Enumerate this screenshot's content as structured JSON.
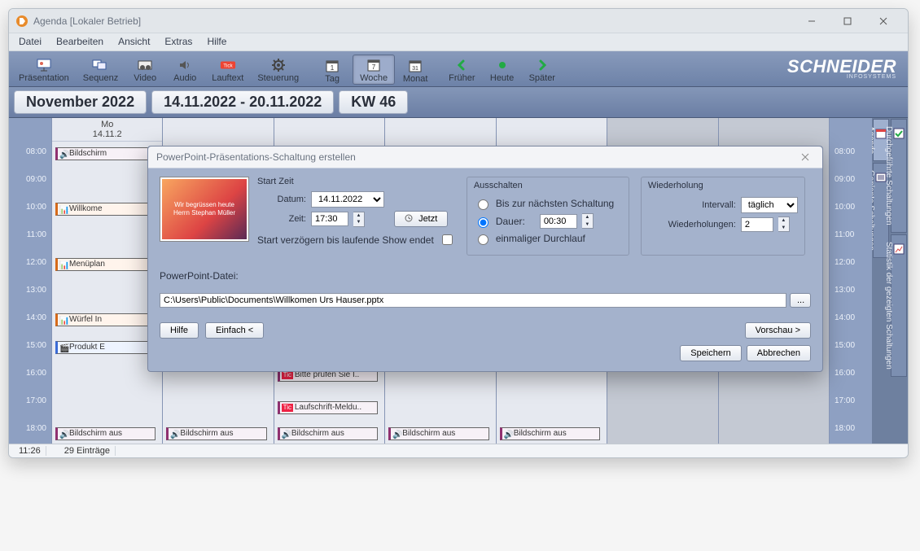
{
  "window": {
    "title": "Agenda [Lokaler Betrieb]"
  },
  "menu": [
    "Datei",
    "Bearbeiten",
    "Ansicht",
    "Extras",
    "Hilfe"
  ],
  "toolbar": {
    "praesentation": "Präsentation",
    "sequenz": "Sequenz",
    "video": "Video",
    "audio": "Audio",
    "lauftext": "Lauftext",
    "steuerung": "Steuerung",
    "tag": "Tag",
    "woche": "Woche",
    "monat": "Monat",
    "frueher": "Früher",
    "heute": "Heute",
    "spaeter": "Später",
    "brand": "SCHNEIDER",
    "brand_sub": "INFOSYSTEMS"
  },
  "date_header": {
    "month": "November 2022",
    "range": "14.11.2022 - 20.11.2022",
    "week": "KW 46"
  },
  "day_head": {
    "dow": "Mo",
    "date": "14.11.2"
  },
  "hours": [
    "08:00",
    "09:00",
    "10:00",
    "11:00",
    "12:00",
    "13:00",
    "14:00",
    "15:00",
    "16:00",
    "17:00",
    "18:00"
  ],
  "items": {
    "bildschirm0": "Bildschirm",
    "willkome": "Willkome",
    "menueplan": "Menüplan",
    "wuerfel": "Würfel In",
    "produkt": "Produkt E",
    "bitte_pruef": "Bitte prüfen Sie I..",
    "laufschrift": "Laufschrift-Meldu..",
    "bildschirm_aus": "Bildschirm aus"
  },
  "vtabs": {
    "agenda": "Agenda",
    "geplant": "Geplante Schaltungen",
    "durch": "Durchgeführte Schaltungen",
    "stat": "Statistik der gezeigten Schaltungen"
  },
  "status": {
    "time": "11:26",
    "entries": "29 Einträge"
  },
  "modal": {
    "title": "PowerPoint-Präsentations-Schaltung erstellen",
    "thumb_caption": "Wir begrüssen heute Herrn Stephan Müller",
    "start": {
      "legend": "Start Zeit",
      "datum_lbl": "Datum:",
      "datum_val": "14.11.2022",
      "zeit_lbl": "Zeit:",
      "zeit_val": "17:30",
      "jetzt": "Jetzt",
      "delay": "Start verzögern bis laufende Show endet"
    },
    "off": {
      "legend": "Ausschalten",
      "opt_next": "Bis zur nächsten Schaltung",
      "opt_dauer": "Dauer:",
      "dauer_val": "00:30",
      "opt_once": "einmaliger Durchlauf"
    },
    "rep": {
      "legend": "Wiederholung",
      "intervall_lbl": "Intervall:",
      "intervall_val": "täglich",
      "wdh_lbl": "Wiederholungen:",
      "wdh_val": "2"
    },
    "file_lbl": "PowerPoint-Datei:",
    "file_val": "C:\\Users\\Public\\Documents\\Willkomen Urs Hauser.pptx",
    "btn_hilfe": "Hilfe",
    "btn_einfach": "Einfach <",
    "btn_vorschau": "Vorschau >",
    "btn_speichern": "Speichern",
    "btn_abbrechen": "Abbrechen",
    "dots": "..."
  }
}
